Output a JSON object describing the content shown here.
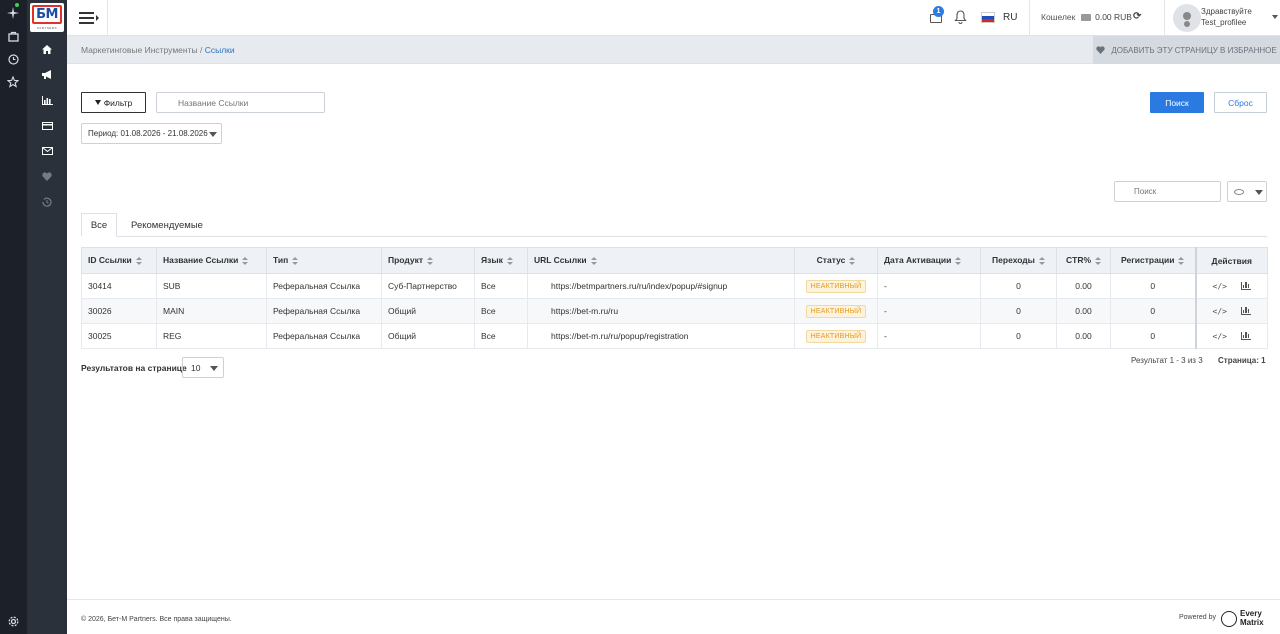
{
  "header": {
    "notifications_count": "1",
    "language": "RU",
    "wallet_label": "Кошелек",
    "wallet_balance": "0.00 RUB",
    "greeting": "Здравствуйте",
    "username": "Test_profilee"
  },
  "breadcrumb": {
    "parent": "Маркетинговые Инструменты",
    "separator": "/",
    "current": "Ссылки",
    "favorite_label": "ДОБАВИТЬ ЭТУ СТРАНИЦУ В ИЗБРАННОЕ"
  },
  "filters": {
    "filter_label": "Фильтр",
    "name_placeholder": "Название Ссылки",
    "period": "Период: 01.08.2026 - 21.08.2026",
    "search_label": "Поиск",
    "reset_label": "Сброс",
    "table_search_placeholder": "Поиск"
  },
  "tabs": [
    {
      "label": "Все",
      "active": true
    },
    {
      "label": "Рекомендуемые",
      "active": false
    }
  ],
  "table": {
    "columns": [
      "ID Ссылки",
      "Название Ссылки",
      "Тип",
      "Продукт",
      "Язык",
      "URL Ссылки",
      "Статус",
      "Дата Активации",
      "Переходы",
      "CTR%",
      "Регистрации",
      "Действия"
    ],
    "rows": [
      {
        "id": "30414",
        "name": "SUB",
        "type": "Реферальная Ссылка",
        "product": "Суб-Партнерство",
        "lang": "Все",
        "url": "https://betmpartners.ru/ru/index/popup/#signup",
        "status": "НЕАКТИВНЫЙ",
        "activated": "-",
        "clicks": "0",
        "ctr": "0.00",
        "regs": "0"
      },
      {
        "id": "30026",
        "name": "MAIN",
        "type": "Реферальная Ссылка",
        "product": "Общий",
        "lang": "Все",
        "url": "https://bet-m.ru/ru",
        "status": "НЕАКТИВНЫЙ",
        "activated": "-",
        "clicks": "0",
        "ctr": "0.00",
        "regs": "0"
      },
      {
        "id": "30025",
        "name": "REG",
        "type": "Реферальная Ссылка",
        "product": "Общий",
        "lang": "Все",
        "url": "https://bet-m.ru/ru/popup/registration",
        "status": "НЕАКТИВНЫЙ",
        "activated": "-",
        "clicks": "0",
        "ctr": "0.00",
        "regs": "0"
      }
    ]
  },
  "pagination": {
    "per_page_label": "Результатов на странице",
    "per_page": "10",
    "results": "Результат 1 - 3 из 3",
    "page_label": "Страница:",
    "page": "1"
  },
  "footer": {
    "copyright": "© 2026, Бет-М Partners. Все права защищены.",
    "powered_by": "Powered by",
    "brand_line1": "Every",
    "brand_line2": "Matrix"
  },
  "logo": {
    "text": "БМ",
    "subtext": "PARTNERS"
  },
  "icons": {
    "rail": [
      "sparkle-icon",
      "bag-icon",
      "clock-icon",
      "star-icon",
      "settings-icon"
    ],
    "sidebar": [
      "home-icon",
      "megaphone-icon",
      "bar-chart-icon",
      "card-icon",
      "mail-icon",
      "heart-icon",
      "history-icon"
    ]
  },
  "colors": {
    "accent": "#2a7ae2",
    "sidebar": "#2a313b",
    "rail": "#1c2129",
    "inactive_status": "#e29a21"
  }
}
